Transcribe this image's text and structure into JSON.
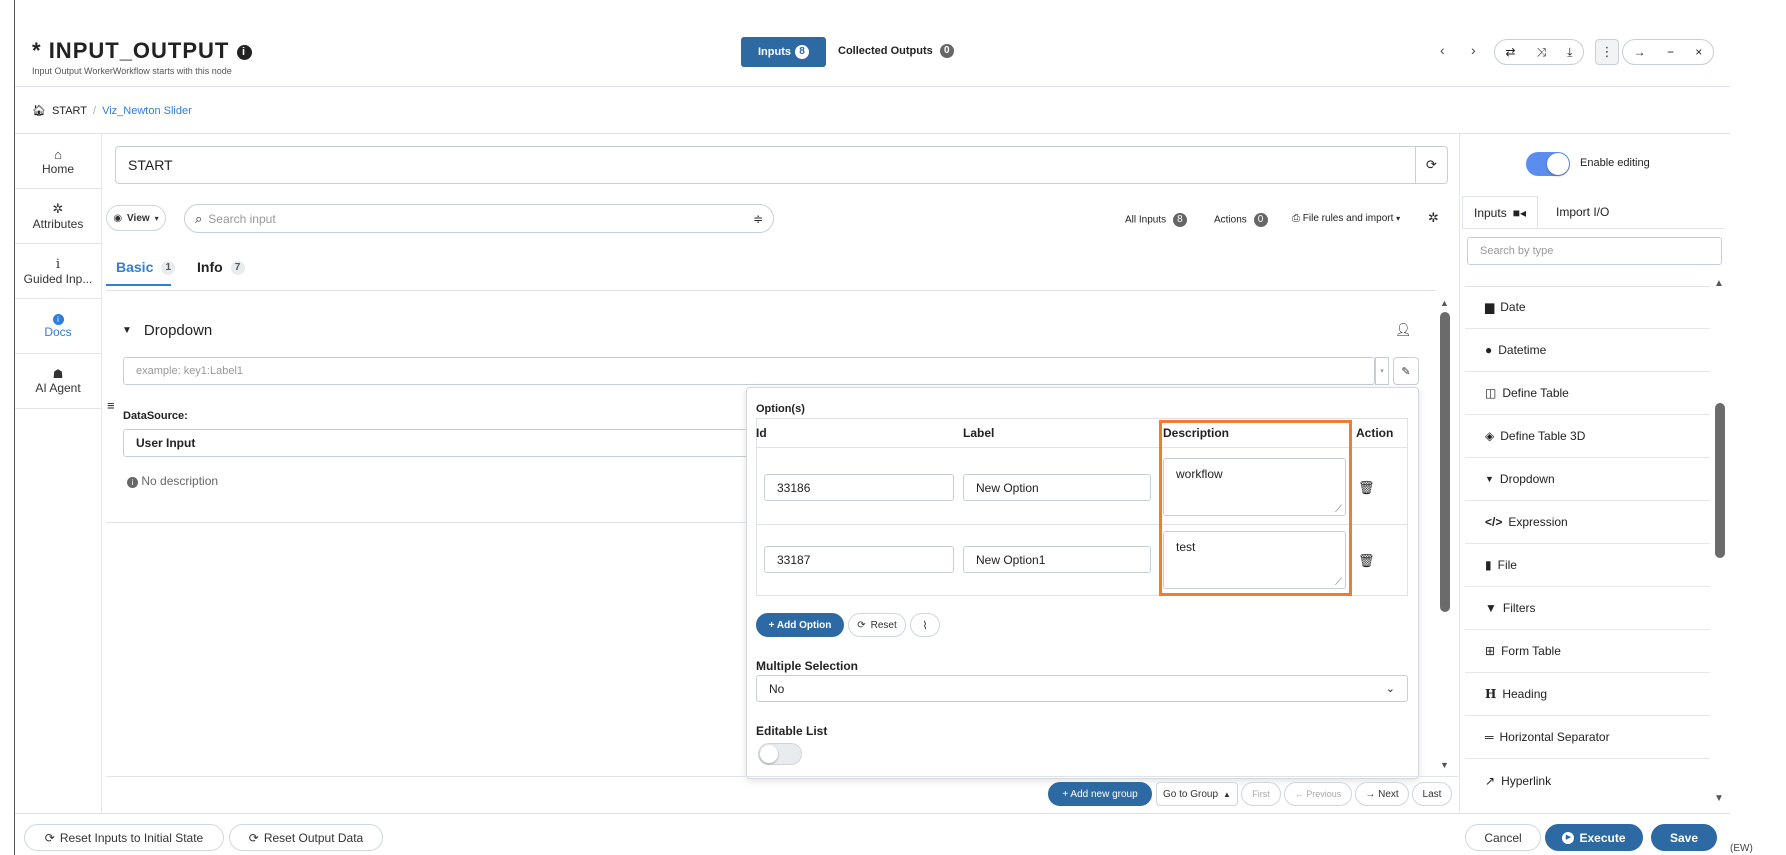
{
  "header": {
    "modified_marker": "*",
    "title": "INPUT_OUTPUT",
    "subtitle": "Input Output WorkerWorkflow starts with this node",
    "tab_inputs_label": "Inputs",
    "tab_inputs_count": "8",
    "tab_outputs_label": "Collected Outputs",
    "tab_outputs_count": "0"
  },
  "breadcrumb": {
    "home": "START",
    "separator": "/",
    "current": "Viz_Newton Slider"
  },
  "sidebar": {
    "items": [
      {
        "label": "Home",
        "icon": "home-icon"
      },
      {
        "label": "Attributes",
        "icon": "gear-icon"
      },
      {
        "label": "Guided Inp...",
        "icon": "info-icon"
      },
      {
        "label": "Docs",
        "icon": "info-circle-icon"
      },
      {
        "label": "AI Agent",
        "icon": "robot-icon"
      }
    ]
  },
  "main": {
    "node_name": "START",
    "view_label": "View",
    "search_placeholder": "Search input",
    "all_inputs_label": "All Inputs",
    "all_inputs_count": "8",
    "actions_label": "Actions",
    "actions_count": "0",
    "file_rules_label": "File rules and import",
    "tabs": [
      {
        "label": "Basic",
        "count": "1"
      },
      {
        "label": "Info",
        "count": "7"
      }
    ],
    "section_title": "Dropdown",
    "dropdown_placeholder": "example: key1:Label1",
    "datasource_label": "DataSource:",
    "datasource_value": "User Input",
    "no_description": "No description"
  },
  "options_popup": {
    "title": "Option(s)",
    "columns": [
      "Id",
      "Label",
      "Description",
      "Action"
    ],
    "rows": [
      {
        "id": "33186",
        "label": "New Option",
        "description": "workflow"
      },
      {
        "id": "33187",
        "label": "New Option1",
        "description": "test"
      }
    ],
    "add_option": "+ Add Option",
    "reset": "Reset",
    "multiple_selection_label": "Multiple Selection",
    "multiple_selection_value": "No",
    "editable_list_label": "Editable List",
    "highlight_color": "#f07d2b"
  },
  "pagination": {
    "add_group": "+ Add new group",
    "go_to_group": "Go to Group",
    "first": "First",
    "previous": "← Previous",
    "next": "→ Next",
    "last": "Last"
  },
  "right_panel": {
    "enable_editing": "Enable editing",
    "tab_inputs": "Inputs",
    "tab_import": "Import I/O",
    "search_placeholder": "Search by type",
    "types": [
      {
        "label": "Date",
        "icon": "calendar-icon"
      },
      {
        "label": "Datetime",
        "icon": "clock-icon"
      },
      {
        "label": "Define Table",
        "icon": "table-icon"
      },
      {
        "label": "Define Table 3D",
        "icon": "cube-icon"
      },
      {
        "label": "Dropdown",
        "icon": "caret-down-icon"
      },
      {
        "label": "Expression",
        "icon": "code-icon"
      },
      {
        "label": "File",
        "icon": "file-icon"
      },
      {
        "label": "Filters",
        "icon": "filter-icon"
      },
      {
        "label": "Form Table",
        "icon": "grid-icon"
      },
      {
        "label": "Heading",
        "icon": "heading-icon"
      },
      {
        "label": "Horizontal Separator",
        "icon": "separator-icon"
      },
      {
        "label": "Hyperlink",
        "icon": "link-icon"
      }
    ]
  },
  "footer": {
    "reset_inputs": "Reset Inputs to Initial State",
    "reset_output": "Reset Output Data",
    "cancel": "Cancel",
    "execute": "Execute",
    "save": "Save",
    "corner_text": "(EW)"
  },
  "colors": {
    "accent": "#2d6aa3",
    "tab_active": "#2f7ed8",
    "toggle_on": "#5b8def"
  }
}
